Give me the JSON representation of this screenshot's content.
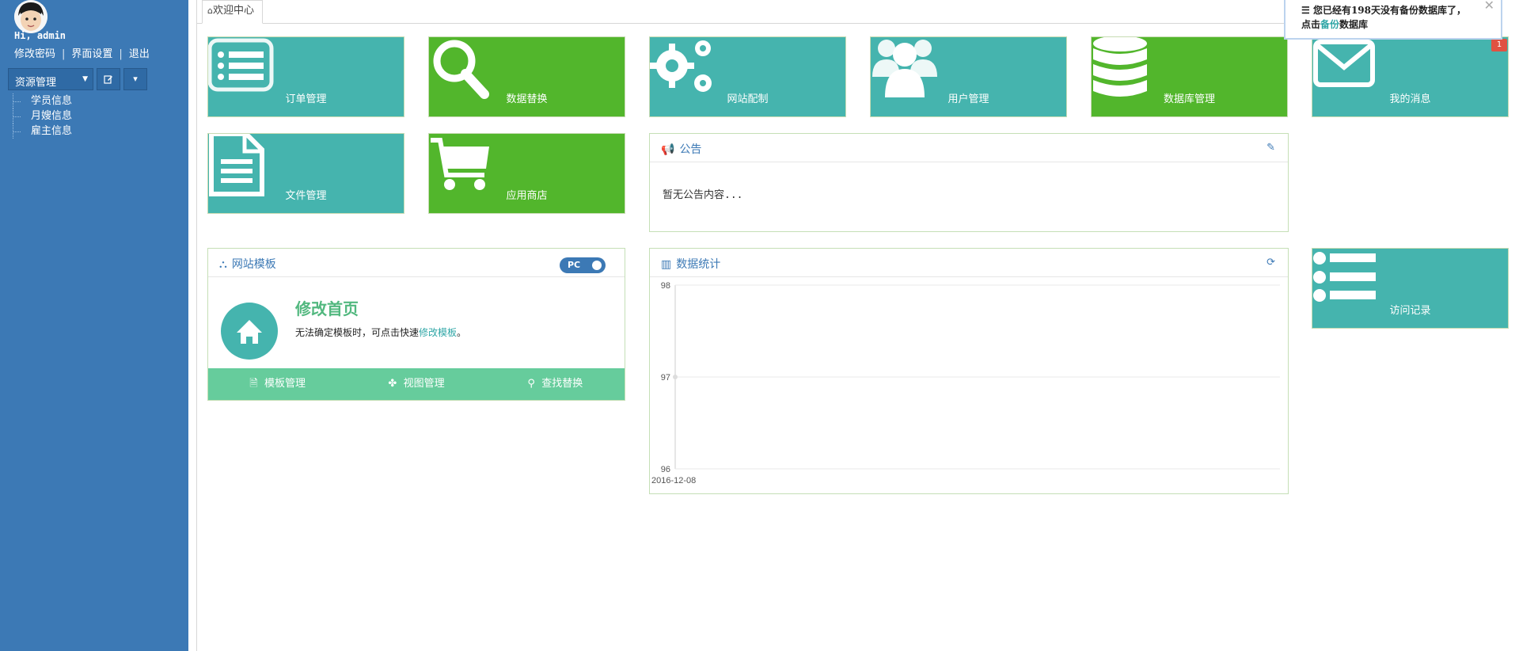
{
  "sidebar": {
    "greeting": "Hi, admin",
    "links": [
      "修改密码",
      "界面设置",
      "退出"
    ],
    "resource_select": "资源管理",
    "tree": [
      "学员信息",
      "月嫂信息",
      "雇主信息"
    ]
  },
  "tabs": [
    {
      "label": "欢迎中心",
      "icon": "home-icon"
    }
  ],
  "tiles": [
    {
      "label": "订单管理",
      "icon": "list-icon",
      "color": "#45b4ae"
    },
    {
      "label": "数据替换",
      "icon": "search-icon",
      "color": "#52b62c"
    },
    {
      "label": "网站配制",
      "icon": "gears-icon",
      "color": "#45b4ae"
    },
    {
      "label": "用户管理",
      "icon": "users-icon",
      "color": "#45b4ae"
    },
    {
      "label": "数据库管理",
      "icon": "database-icon",
      "color": "#52b62c"
    },
    {
      "label": "我的消息",
      "icon": "envelope-icon",
      "color": "#45b4ae",
      "badge": "1"
    },
    {
      "label": "文件管理",
      "icon": "file-icon",
      "color": "#45b4ae"
    },
    {
      "label": "应用商店",
      "icon": "cart-icon",
      "color": "#52b62c"
    },
    {
      "label": "访问记录",
      "icon": "list-bullet-icon",
      "color": "#45b4ae"
    }
  ],
  "notice_panel": {
    "title": "公告",
    "body": "暂无公告内容..."
  },
  "template_panel": {
    "title": "网站模板",
    "toggle": "PC",
    "heading": "修改首页",
    "desc_prefix": "无法确定模板时，可点击快速",
    "desc_link": "修改模板",
    "desc_suffix": "。",
    "actions": [
      "模板管理",
      "视图管理",
      "查找替换"
    ]
  },
  "stats_panel": {
    "title": "数据统计"
  },
  "toast": {
    "line1": "您已经有198天没有备份数据库了，",
    "line2_prefix": "点击",
    "line2_link": "备份",
    "line2_suffix": "数据库"
  },
  "chart_data": {
    "type": "line",
    "x": [
      "2016-12-08"
    ],
    "series": [
      {
        "values": [
          97
        ]
      }
    ],
    "ylim": [
      96,
      98
    ],
    "yticks": [
      "98",
      "97",
      "96"
    ],
    "grid": true
  }
}
